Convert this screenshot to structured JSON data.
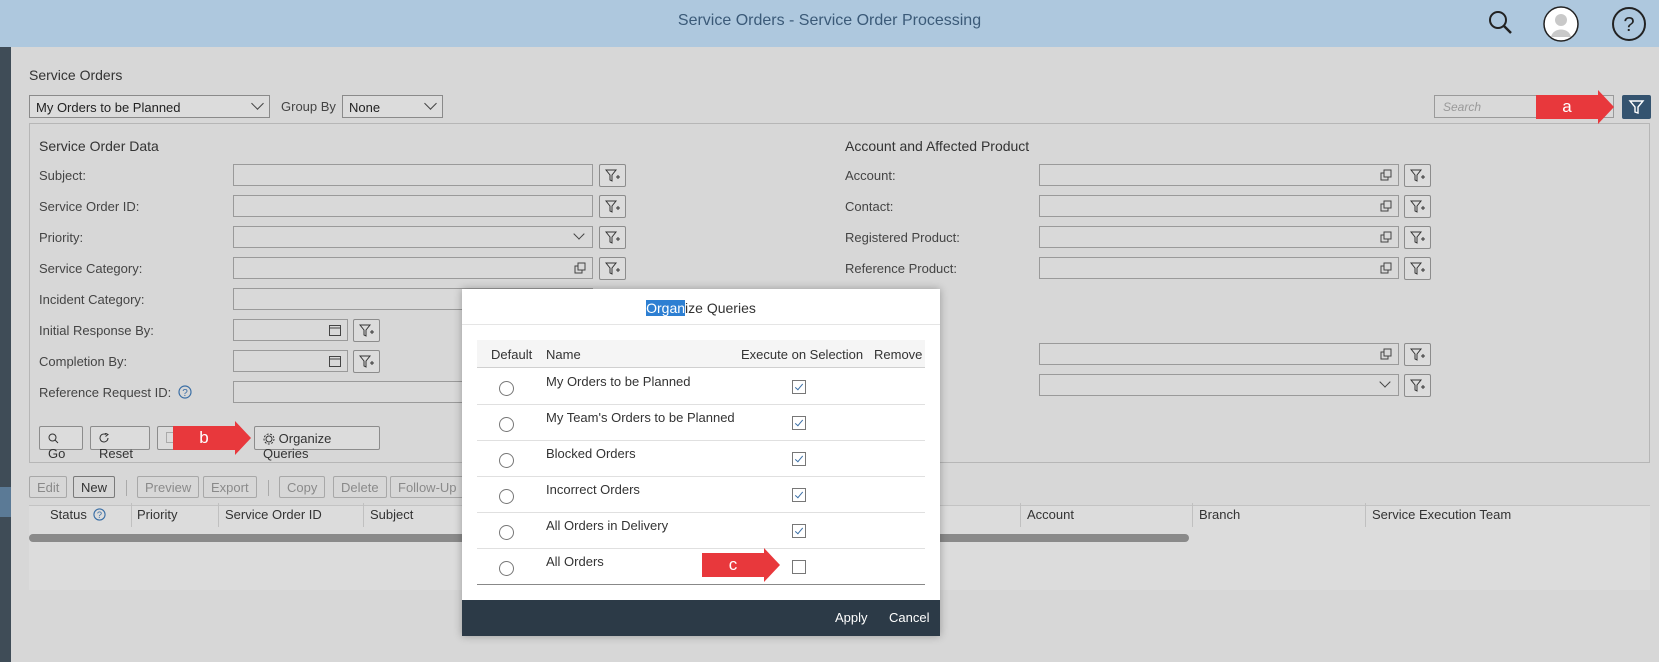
{
  "shell": {
    "title": "Service Orders - Service Order Processing",
    "icons": [
      "search-icon",
      "user-avatar-icon",
      "help-icon"
    ]
  },
  "page": {
    "title": "Service Orders",
    "query_select": "My Orders to be Planned",
    "group_by_label": "Group By",
    "group_by_value": "None",
    "search_placeholder": "Search"
  },
  "filters": {
    "left_title": "Service Order Data",
    "right_title": "Account and Affected Product",
    "left_fields": [
      "Subject:",
      "Service Order ID:",
      "Priority:",
      "Service Category:",
      "Incident Category:",
      "Initial Response By:",
      "Completion By:",
      "Reference Request ID:"
    ],
    "right_fields": [
      "Account:",
      "Contact:",
      "Registered Product:",
      "Reference Product:"
    ],
    "buttons": {
      "go": "Go",
      "reset": "Reset",
      "organize": "Organize Queries"
    }
  },
  "toolbar": {
    "edit": "Edit",
    "new": "New",
    "preview": "Preview",
    "export": "Export",
    "copy": "Copy",
    "delete": "Delete",
    "follow_up": "Follow-Up"
  },
  "table": {
    "columns": [
      "Status",
      "Priority",
      "Service Order ID",
      "Subject",
      "Account",
      "Branch",
      "Service Execution Team"
    ]
  },
  "annotations": {
    "a": "a",
    "b": "b",
    "c": "c"
  },
  "dialog": {
    "title_highlight": "Organ",
    "title_rest": "ize Queries",
    "columns": {
      "default": "Default",
      "name": "Name",
      "execute": "Execute on Selection",
      "remove": "Remove"
    },
    "rows": [
      {
        "name": "My Orders to be Planned",
        "execute": true
      },
      {
        "name": "My Team's Orders to be Planned",
        "execute": true
      },
      {
        "name": "Blocked Orders",
        "execute": true
      },
      {
        "name": "Incorrect Orders",
        "execute": true
      },
      {
        "name": "All Orders in Delivery",
        "execute": true
      },
      {
        "name": "All Orders",
        "execute": false
      }
    ],
    "apply": "Apply",
    "cancel": "Cancel"
  },
  "colors": {
    "shell": "#aec8de",
    "dialog_footer": "#2c3a47",
    "annotation": "#e8383c",
    "filter_button": "#34536f"
  }
}
